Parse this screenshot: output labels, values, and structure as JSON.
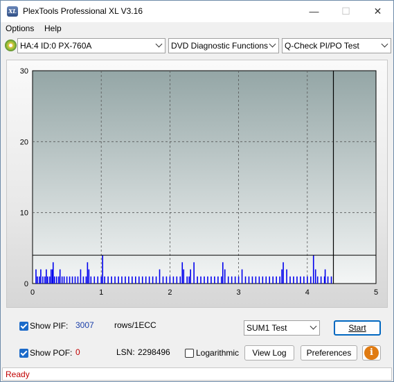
{
  "window": {
    "title": "PlexTools Professional XL V3.16",
    "icon_label": "XL",
    "controls": {
      "minimize": "—",
      "maximize": "☐",
      "close": "✕"
    }
  },
  "menu": {
    "options": "Options",
    "help": "Help"
  },
  "toolbar": {
    "drive": "HA:4 ID:0  PX-760A",
    "function": "DVD Diagnostic Functions",
    "test": "Q-Check PI/PO Test"
  },
  "controls": {
    "show_pif_label": "Show PIF:",
    "pif_value": "3007",
    "pif_unit": "rows/1ECC",
    "show_pof_label": "Show POF:",
    "pof_value": "0",
    "lsn_label": "LSN:",
    "lsn_value": "2298496",
    "logarithmic_label": "Logarithmic",
    "sum_select": "SUM1 Test",
    "start": "Start",
    "view_log": "View Log",
    "preferences": "Preferences",
    "info_icon": "i"
  },
  "status": {
    "text": "Ready"
  },
  "colors": {
    "pif_value": "#1a3ea8",
    "pof_value": "#c00000",
    "status_text": "#c00000",
    "bars": "#0000ee",
    "plot_top": "#94a6a6",
    "plot_bottom": "#f4f6f6"
  },
  "chart_data": {
    "type": "bar",
    "x_ticks": [
      "0",
      "1",
      "2",
      "3",
      "4",
      "5"
    ],
    "y_ticks": [
      "0",
      "10",
      "20",
      "30"
    ],
    "xlim": [
      0,
      5
    ],
    "ylim": [
      0,
      30
    ],
    "grid": true,
    "threshold": 4,
    "end_marker_x": 4.38,
    "series": [
      {
        "x": [
          0.05,
          0.07,
          0.1,
          0.12,
          0.15,
          0.18,
          0.2,
          0.22,
          0.25,
          0.27,
          0.29,
          0.3,
          0.32,
          0.35,
          0.38,
          0.4,
          0.43,
          0.46,
          0.5,
          0.54,
          0.58,
          0.62,
          0.66,
          0.7,
          0.74,
          0.78,
          0.8,
          0.82,
          0.85,
          0.9,
          0.95,
          1.0,
          1.02,
          1.05,
          1.1,
          1.15,
          1.2,
          1.25,
          1.3,
          1.35,
          1.4,
          1.45,
          1.5,
          1.55,
          1.6,
          1.65,
          1.7,
          1.75,
          1.8,
          1.85,
          1.9,
          1.95,
          2.0,
          2.05,
          2.1,
          2.15,
          2.18,
          2.2,
          2.25,
          2.28,
          2.3,
          2.35,
          2.4,
          2.45,
          2.5,
          2.55,
          2.6,
          2.65,
          2.7,
          2.75,
          2.77,
          2.8,
          2.85,
          2.9,
          2.95,
          3.0,
          3.05,
          3.1,
          3.15,
          3.2,
          3.25,
          3.3,
          3.35,
          3.4,
          3.45,
          3.5,
          3.55,
          3.6,
          3.63,
          3.65,
          3.7,
          3.75,
          3.8,
          3.85,
          3.9,
          3.95,
          4.0,
          4.05,
          4.09,
          4.12,
          4.15,
          4.2,
          4.25,
          4.26,
          4.3,
          4.35
        ],
        "values": [
          2,
          1,
          1,
          2,
          1,
          1,
          2,
          1,
          1,
          2,
          2,
          3,
          1,
          1,
          1,
          2,
          1,
          1,
          1,
          1,
          1,
          1,
          1,
          2,
          1,
          1,
          3,
          2,
          1,
          1,
          1,
          1,
          4,
          1,
          1,
          1,
          1,
          1,
          1,
          1,
          1,
          1,
          1,
          1,
          1,
          1,
          1,
          1,
          1,
          2,
          1,
          1,
          1,
          1,
          1,
          1,
          3,
          2,
          1,
          1,
          2,
          3,
          1,
          1,
          1,
          1,
          1,
          1,
          1,
          1,
          3,
          2,
          1,
          1,
          1,
          1,
          2,
          1,
          1,
          1,
          1,
          1,
          1,
          1,
          1,
          1,
          1,
          1,
          2,
          3,
          2,
          1,
          1,
          1,
          1,
          1,
          1,
          1,
          4,
          2,
          1,
          1,
          1,
          2,
          1,
          1
        ]
      }
    ]
  }
}
